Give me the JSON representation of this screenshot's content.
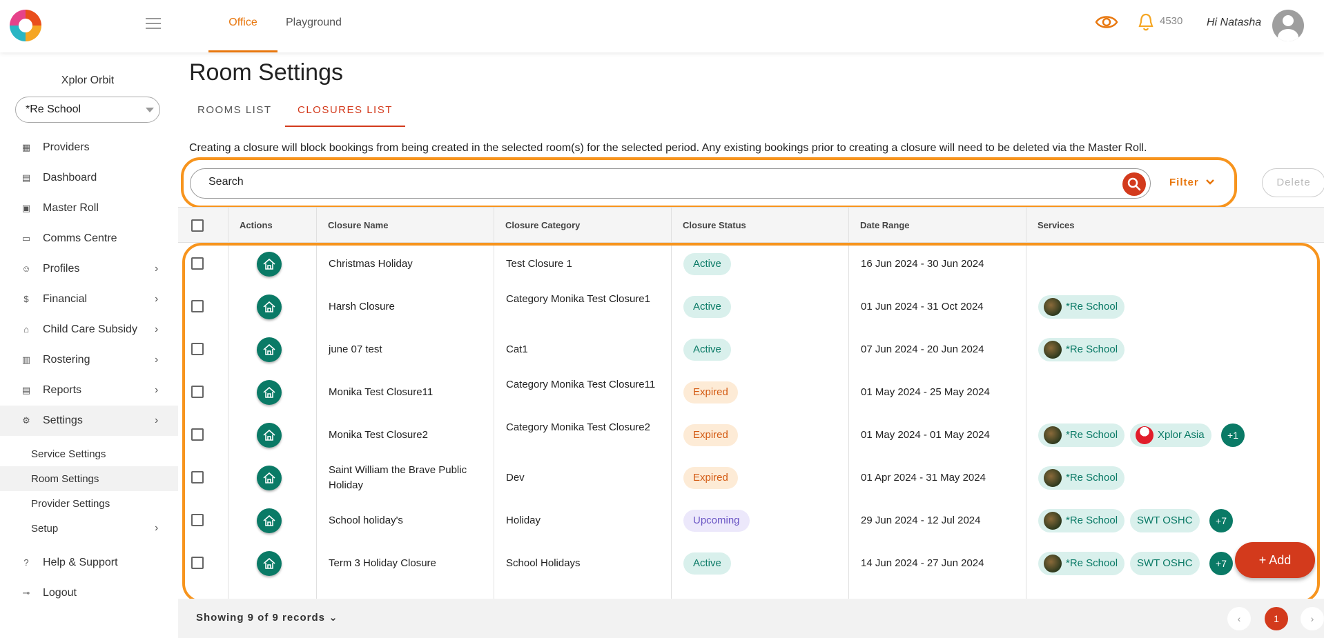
{
  "topbar": {
    "tabs": [
      "Office",
      "Playground"
    ],
    "notification_count": "4530",
    "greeting": "Hi Natasha"
  },
  "sidebar": {
    "org_name": "Xplor Orbit",
    "school_select": "*Re School",
    "items": [
      {
        "label": "Providers",
        "icon": "providers-icon"
      },
      {
        "label": "Dashboard",
        "icon": "dashboard-icon"
      },
      {
        "label": "Master Roll",
        "icon": "calendar-icon"
      },
      {
        "label": "Comms Centre",
        "icon": "comms-icon"
      },
      {
        "label": "Profiles",
        "icon": "profiles-icon"
      },
      {
        "label": "Financial",
        "icon": "dollar-icon"
      },
      {
        "label": "Child Care Subsidy",
        "icon": "bank-icon"
      },
      {
        "label": "Rostering",
        "icon": "roster-icon"
      },
      {
        "label": "Reports",
        "icon": "reports-icon"
      },
      {
        "label": "Settings",
        "icon": "gear-icon"
      }
    ],
    "sub_items": [
      "Service Settings",
      "Room Settings",
      "Provider Settings",
      "Setup"
    ],
    "bottom_items": [
      "Help & Support",
      "Logout"
    ]
  },
  "main": {
    "title": "Room Settings",
    "tabs": [
      "ROOMS LIST",
      "CLOSURES LIST"
    ],
    "notice": "Creating a closure will block bookings from being created in the selected room(s) for the selected period. Any existing bookings prior to creating a closure will need to be deleted via the Master Roll.",
    "search_placeholder": "Search",
    "filter_label": "Filter",
    "delete_label": "Delete",
    "add_label": "Add",
    "records_label": "Showing 9 of 9 records",
    "current_page": "1"
  },
  "table": {
    "headers": [
      "Actions",
      "Closure Name",
      "Closure Category",
      "Closure Status",
      "Date Range",
      "Services"
    ],
    "rows": [
      {
        "name": "Christmas Holiday",
        "category": "Test Closure 1",
        "status": "Active",
        "status_class": "active",
        "dates": "16 Jun 2024 - 30 Jun 2024",
        "services": [],
        "more": ""
      },
      {
        "name": "Harsh Closure",
        "category": "Category Monika Test Closure1",
        "status": "Active",
        "status_class": "active",
        "dates": "01 Jun 2024 - 31 Oct 2024",
        "services": [
          {
            "label": "*Re School",
            "avatar": "photo"
          }
        ],
        "more": ""
      },
      {
        "name": "june 07 test",
        "category": "Cat1",
        "status": "Active",
        "status_class": "active",
        "dates": "07 Jun 2024 - 20 Jun 2024",
        "services": [
          {
            "label": "*Re School",
            "avatar": "photo"
          }
        ],
        "more": ""
      },
      {
        "name": "Monika Test Closure11",
        "category": "Category Monika Test Closure11",
        "status": "Expired",
        "status_class": "expired",
        "dates": "01 May 2024 - 25 May 2024",
        "services": [],
        "more": ""
      },
      {
        "name": "Monika Test Closure2",
        "category": "Category Monika Test Closure2",
        "status": "Expired",
        "status_class": "expired",
        "dates": "01 May 2024 - 01 May 2024",
        "services": [
          {
            "label": "*Re School",
            "avatar": "photo"
          },
          {
            "label": "Xplor Asia",
            "avatar": "sg"
          }
        ],
        "more": "+1"
      },
      {
        "name": "Saint William the Brave Public Holiday",
        "category": "Dev",
        "status": "Expired",
        "status_class": "expired",
        "dates": "01 Apr 2024 - 31 May 2024",
        "services": [
          {
            "label": "*Re School",
            "avatar": "photo"
          }
        ],
        "more": ""
      },
      {
        "name": "School holiday's",
        "category": "Holiday",
        "status": "Upcoming",
        "status_class": "upcoming",
        "dates": "29 Jun 2024 - 12 Jul 2024",
        "services": [
          {
            "label": "*Re School",
            "avatar": "photo"
          },
          {
            "label": "SWT OSHC",
            "avatar": ""
          }
        ],
        "more": "+7"
      },
      {
        "name": "Term 3 Holiday Closure",
        "category": "School Holidays",
        "status": "Active",
        "status_class": "active",
        "dates": "14 Jun 2024 - 27 Jun 2024",
        "services": [
          {
            "label": "*Re School",
            "avatar": "photo"
          },
          {
            "label": "SWT OSHC",
            "avatar": ""
          }
        ],
        "more": "+7"
      }
    ]
  },
  "colors": {
    "accent_orange": "#e8770e",
    "brand_red": "#d33a1c",
    "teal": "#0a7a66",
    "highlight": "#f7941d"
  }
}
